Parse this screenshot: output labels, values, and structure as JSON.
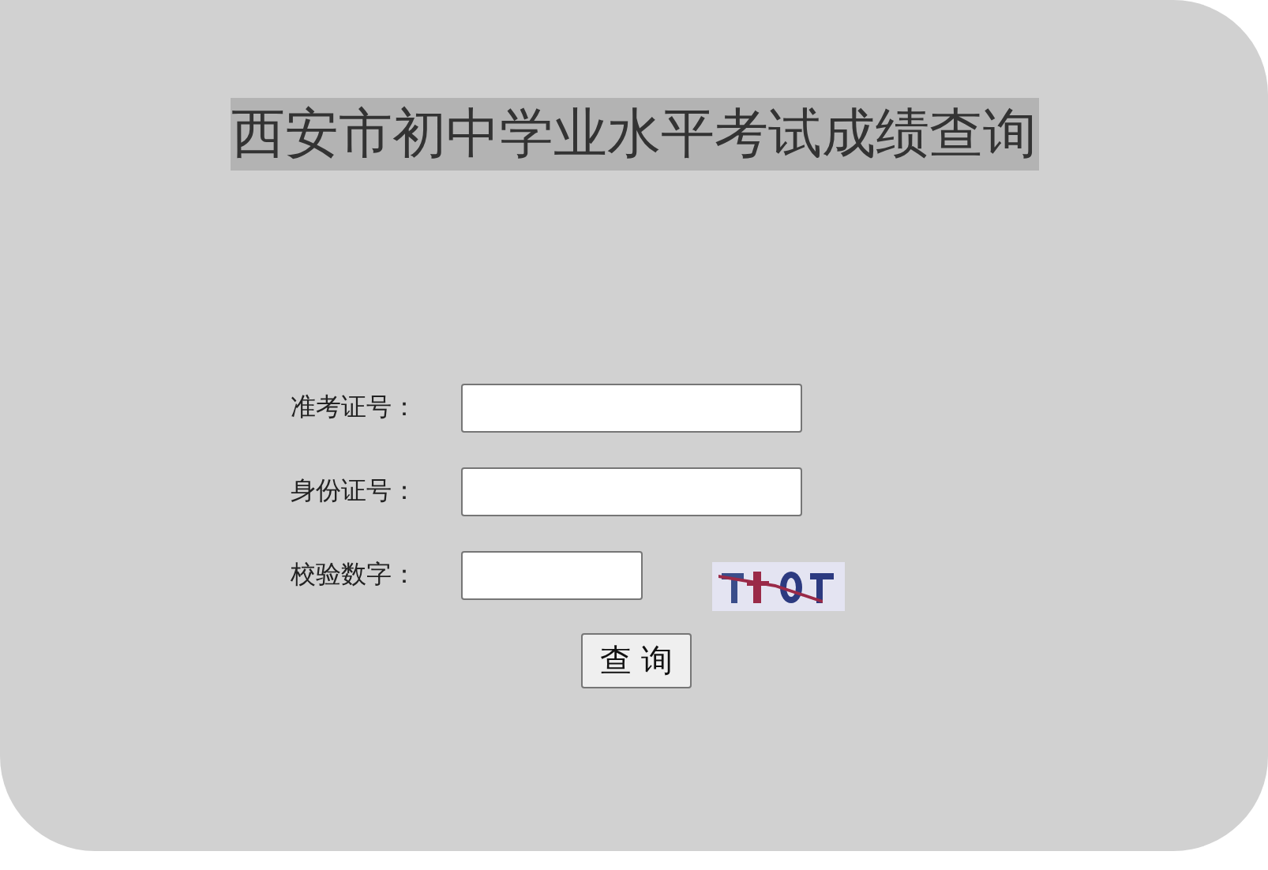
{
  "title": "西安市初中学业水平考试成绩查询",
  "fields": [
    {
      "label": "准考证号："
    },
    {
      "label": "身份证号："
    }
  ],
  "captcha": {
    "label": "校验数字："
  },
  "button": "查 询"
}
